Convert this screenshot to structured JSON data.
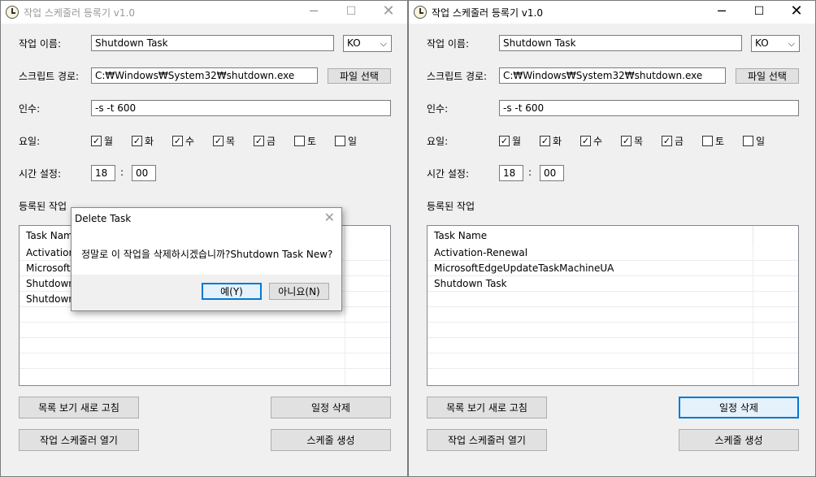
{
  "app": {
    "title": "작업 스케줄러 등록기 v1.0",
    "min_icon": "─",
    "max_icon": "☐",
    "close_icon": "✕"
  },
  "form": {
    "task_name_label": "작업 이름:",
    "task_name_value": "Shutdown Task",
    "lang_value": "KO",
    "lang_arrow": "⌵",
    "script_path_label": "스크립트 경로:",
    "script_path_value": "C:₩Windows₩System32₩shutdown.exe",
    "file_select_label": "파일 선택",
    "args_label": "인수:",
    "args_value": "-s -t 600",
    "days_label": "요일:",
    "days": [
      {
        "label": "월",
        "checked": true
      },
      {
        "label": "화",
        "checked": true
      },
      {
        "label": "수",
        "checked": true
      },
      {
        "label": "목",
        "checked": true
      },
      {
        "label": "금",
        "checked": true
      },
      {
        "label": "토",
        "checked": false
      },
      {
        "label": "일",
        "checked": false
      }
    ],
    "check_mark": "✓",
    "time_label": "시간 설정:",
    "hour_value": "18",
    "time_sep": ":",
    "minute_value": "00"
  },
  "registered": {
    "label": "등록된 작업",
    "column_header": "Task Name",
    "left_rows": [
      "Activation-",
      "MicrosoftE",
      "Shutdown",
      "Shutdown"
    ],
    "right_rows": [
      "Activation-Renewal",
      "MicrosoftEdgeUpdateTaskMachineUA",
      "Shutdown Task"
    ]
  },
  "buttons": {
    "refresh": "목록 보기 새로 고침",
    "delete": "일정 삭제",
    "open_scheduler": "작업 스케줄러 열기",
    "create": "스케줄 생성"
  },
  "dialog": {
    "title": "Delete Task",
    "close_icon": "✕",
    "message": "정말로 이 작업을 삭제하시겠습니까?Shutdown Task New?",
    "yes_label": "예(Y)",
    "no_label": "아니요(N)"
  }
}
